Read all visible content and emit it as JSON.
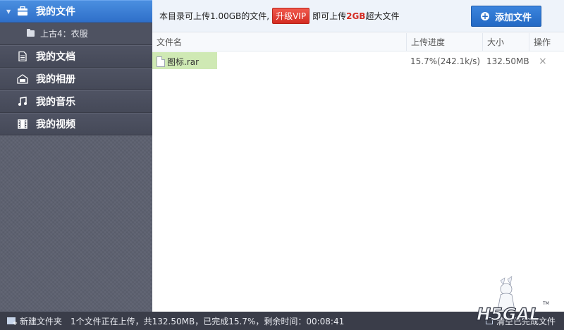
{
  "sidebar": {
    "items": [
      {
        "label": "我的文件",
        "icon": "briefcase-icon",
        "active": true
      },
      {
        "label": "上古4：衣服",
        "icon": "folder-icon",
        "sub": true
      },
      {
        "label": "我的文档",
        "icon": "document-icon"
      },
      {
        "label": "我的相册",
        "icon": "photo-album-icon"
      },
      {
        "label": "我的音乐",
        "icon": "music-note-icon"
      },
      {
        "label": "我的视频",
        "icon": "film-icon"
      }
    ]
  },
  "topbar": {
    "notice_prefix": "本目录可上传1.00GB的文件,",
    "vip_label": "升级VIP",
    "notice_mid": "即可上传",
    "notice_highlight": "2GB",
    "notice_suffix": "超大文件",
    "add_button": "添加文件"
  },
  "table": {
    "headers": {
      "name": "文件名",
      "progress": "上传进度",
      "size": "大小",
      "action": "操作"
    },
    "rows": [
      {
        "name": "图标.rar",
        "progress": "15.7%(242.1k/s)",
        "progress_fraction": 0.157,
        "size": "132.50MB",
        "action": "×"
      }
    ]
  },
  "statusbar": {
    "new_folder": "新建文件夹",
    "status": "1个文件正在上传，共132.50MB，已完成15.7%，剩余时间：00:08:41",
    "clear": "清空已完成文件"
  },
  "watermark": {
    "text": "H5GAL"
  },
  "colors": {
    "accent": "#2f6fc9",
    "sidebar": "#4f5363",
    "vip": "#d42c22",
    "progress": "#cfe9b4"
  }
}
